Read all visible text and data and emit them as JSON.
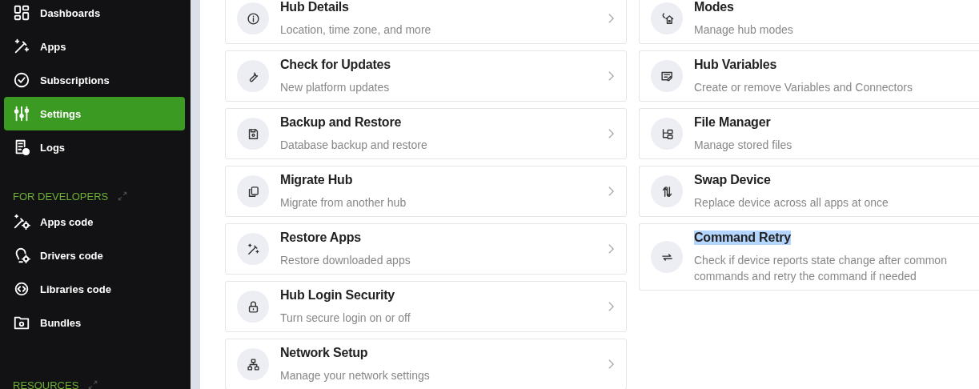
{
  "sidebar": {
    "sections": [
      {
        "items": [
          {
            "label": "Dashboards",
            "selected": false
          },
          {
            "label": "Apps",
            "selected": false
          },
          {
            "label": "Subscriptions",
            "selected": false
          },
          {
            "label": "Settings",
            "selected": true
          },
          {
            "label": "Logs",
            "selected": false
          }
        ]
      },
      {
        "heading": "FOR DEVELOPERS",
        "items": [
          {
            "label": "Apps code",
            "selected": false
          },
          {
            "label": "Drivers code",
            "selected": false
          },
          {
            "label": "Libraries code",
            "selected": false
          },
          {
            "label": "Bundles",
            "selected": false
          }
        ]
      },
      {
        "heading": "RESOURCES"
      }
    ]
  },
  "settings": {
    "columns": [
      {
        "chevrons": true,
        "cards": [
          {
            "title": "Hub Details",
            "description": "Location, time zone, and more",
            "highlighted": false
          },
          {
            "title": "Check for Updates",
            "description": "New platform updates",
            "highlighted": false
          },
          {
            "title": "Backup and Restore",
            "description": "Database backup and restore",
            "highlighted": false
          },
          {
            "title": "Migrate Hub",
            "description": "Migrate from another hub",
            "highlighted": false
          },
          {
            "title": "Restore Apps",
            "description": "Restore downloaded apps",
            "highlighted": false
          },
          {
            "title": "Hub Login Security",
            "description": "Turn secure login on or off",
            "highlighted": false
          },
          {
            "title": "Network Setup",
            "description": "Manage your network settings",
            "highlighted": false
          }
        ]
      },
      {
        "chevrons": false,
        "cards": [
          {
            "title": "Modes",
            "description": "Manage hub modes",
            "highlighted": false
          },
          {
            "title": "Hub Variables",
            "description": "Create or remove Variables and Connectors",
            "highlighted": false
          },
          {
            "title": "File Manager",
            "description": "Manage stored files",
            "highlighted": false
          },
          {
            "title": "Swap Device",
            "description": "Replace device across all apps at once",
            "highlighted": false
          },
          {
            "title": "Command Retry",
            "description": "Check if device reports state change after common commands and retry the command if needed",
            "highlighted": true
          }
        ]
      }
    ]
  }
}
